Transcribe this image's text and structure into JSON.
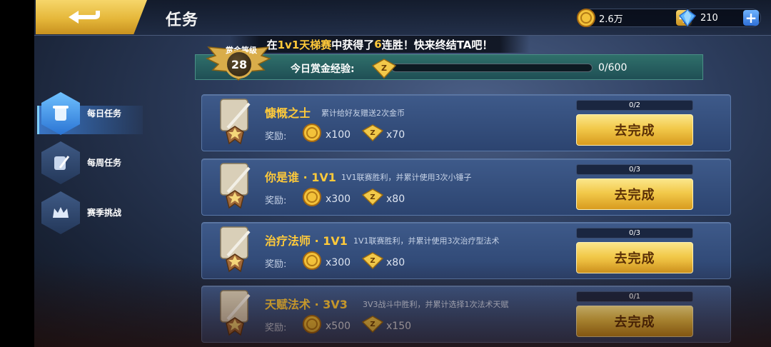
{
  "header": {
    "title": "任务",
    "gold": "2.6万",
    "gems": "210"
  },
  "announcement": {
    "before": "在",
    "mode": "1v1天梯赛",
    "middle": "中获得了",
    "count": "6",
    "after": "连胜！快来终结TA吧！"
  },
  "bounty": {
    "label": "赏金等级",
    "level": "28",
    "exp_label": "今日赏金经验:",
    "exp_text": "0/600",
    "exp_fraction": 0
  },
  "sidebar": {
    "items": [
      {
        "label": "每日任务",
        "active": true
      },
      {
        "label": "每周任务",
        "active": false
      },
      {
        "label": "赛季挑战",
        "active": false
      }
    ]
  },
  "reward_label": "奖励:",
  "tasks": [
    {
      "name": "慷慨之士",
      "desc": "累计给好友赠送2次金币",
      "coins": "x100",
      "exp": "x70",
      "progress": "0/2",
      "progress_fraction": 0,
      "button": "去完成"
    },
    {
      "name": "你是谁 · 1V1",
      "desc": "1V1联赛胜利，并累计使用3次小锤子",
      "coins": "x300",
      "exp": "x80",
      "progress": "0/3",
      "progress_fraction": 0,
      "button": "去完成"
    },
    {
      "name": "治疗法师 · 1V1",
      "desc": "1V1联赛胜利，并累计使用3次治疗型法术",
      "coins": "x300",
      "exp": "x80",
      "progress": "0/3",
      "progress_fraction": 0,
      "button": "去完成"
    },
    {
      "name": "天赋法术 · 3V3",
      "desc": "3V3战斗中胜利，并累计选择1次法术天赋",
      "coins": "x500",
      "exp": "x150",
      "progress": "0/1",
      "progress_fraction": 0,
      "button": "去完成"
    }
  ]
}
